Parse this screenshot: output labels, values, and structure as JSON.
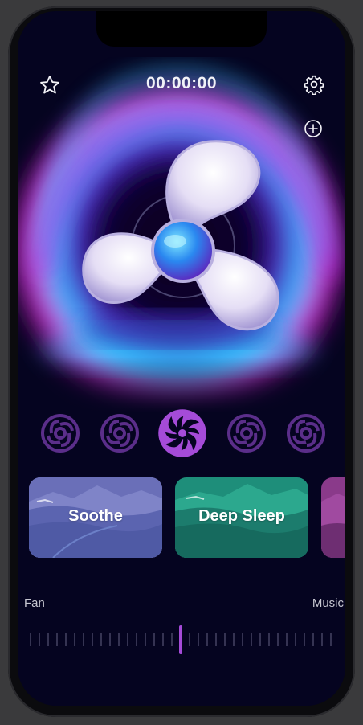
{
  "timer": {
    "value": "00:00:00"
  },
  "icons": {
    "favorite": "star-icon",
    "settings": "gear-icon",
    "add": "plus-circle-icon"
  },
  "fan_selector": {
    "options": [
      "fan-1",
      "fan-2",
      "fan-3",
      "fan-4",
      "fan-5"
    ],
    "selected_index": 2
  },
  "modes": [
    {
      "label": "Soothe",
      "color": "#4f5aa5"
    },
    {
      "label": "Deep Sleep",
      "color": "#1c7c6d"
    },
    {
      "label": "",
      "color": "#8a3a8a"
    }
  ],
  "mix": {
    "left_label": "Fan",
    "right_label": "Music",
    "position_fraction": 0.5
  },
  "colors": {
    "background": "#050420",
    "accent": "#a54bd8",
    "glow_cyan": "#1fd3ff",
    "glow_magenta": "#e31fd8"
  }
}
